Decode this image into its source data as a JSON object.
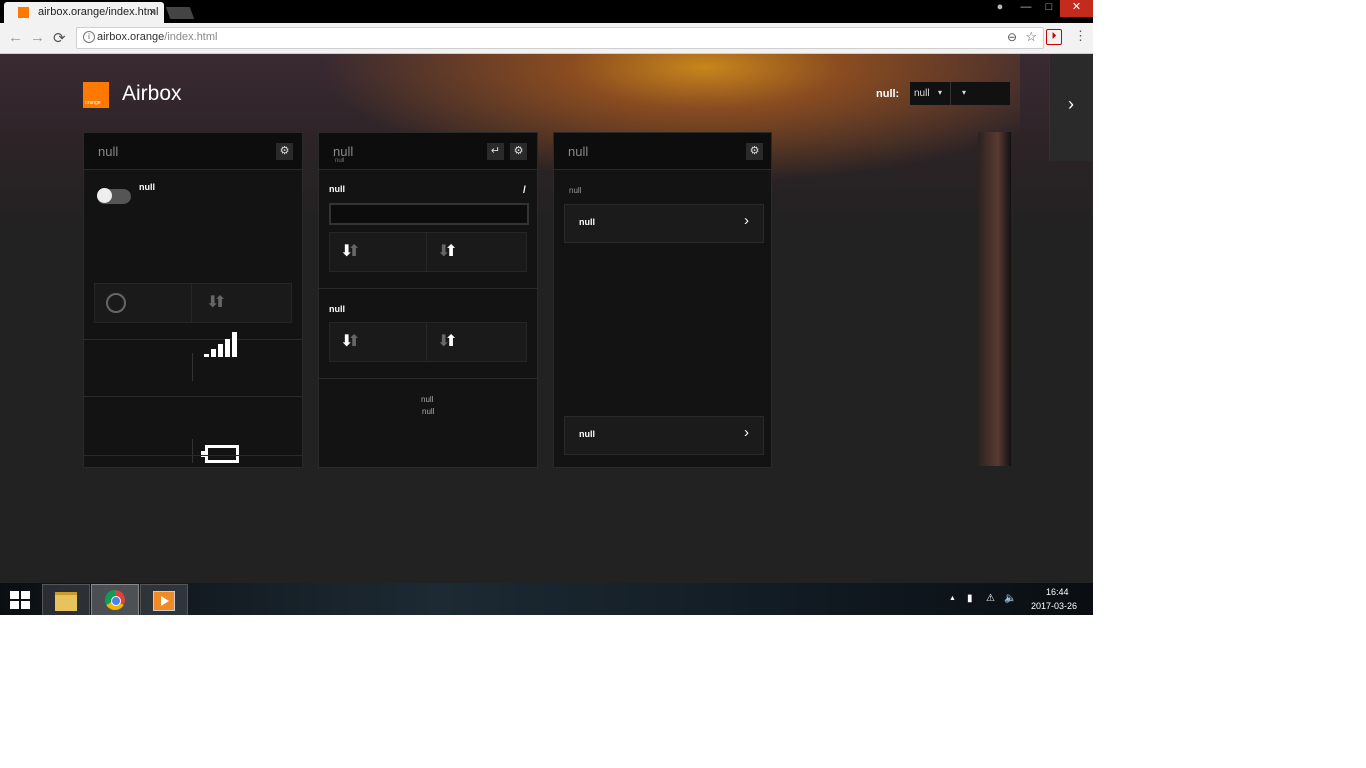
{
  "browser": {
    "tab_title": "airbox.orange/index.html",
    "tab_close": "×",
    "url_host": "airbox.orange",
    "url_path": "/index.html",
    "back": "←",
    "forward": "→",
    "reload": "⟳",
    "info": "i",
    "zoom": "⊖",
    "star": "☆",
    "ext": "⏵",
    "menu": "⋮",
    "win_user": "●",
    "win_min": "—",
    "win_max": "□",
    "win_close": "✕"
  },
  "header": {
    "logo_text": "orange",
    "app_title": "Airbox",
    "select_label": "null:",
    "select_value": "null",
    "caret": "▾",
    "side_next": "›"
  },
  "card1": {
    "title": "null",
    "gear": "⚙",
    "toggle_label": "null",
    "arrows_a": "⬇",
    "arrows_b": "⬆"
  },
  "card2": {
    "title": "null",
    "subtitle": "null",
    "undo": "↵",
    "gear": "⚙",
    "label1": "null",
    "edit_mark": "/",
    "label2": "null",
    "footer1": "null",
    "footer2": "null",
    "down": "⬇",
    "up": "⬆"
  },
  "card3": {
    "title": "null",
    "gear": "⚙",
    "caption": "null",
    "row1": "null",
    "row2": "null",
    "chev": "›"
  },
  "taskbar": {
    "tray_caret": "▲",
    "tray_net": "▮",
    "tray_wifi": "⚠",
    "tray_vol": "🔈",
    "time": "16:44",
    "date": "2017-03-26"
  },
  "colors": {
    "brand": "#ff7900",
    "card_bg": "#131313",
    "page_bg": "#222222"
  }
}
